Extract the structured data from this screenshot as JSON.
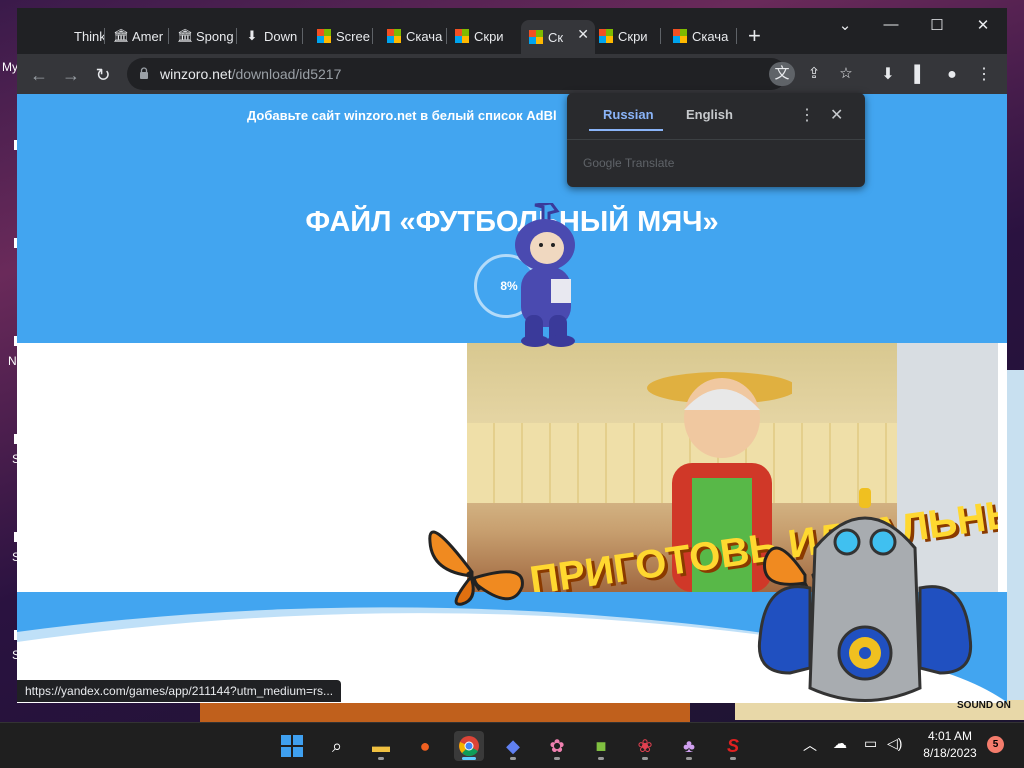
{
  "desktop": {
    "labels": [
      "My",
      "N",
      "S",
      "S",
      "S"
    ]
  },
  "tabs": [
    {
      "label": "Think",
      "icon": "document-icon"
    },
    {
      "label": "Amer",
      "icon": "bank-icon"
    },
    {
      "label": "Spong",
      "icon": "bank-icon"
    },
    {
      "label": "Down",
      "icon": "download-icon"
    },
    {
      "label": "Scree",
      "icon": "microsoft-icon"
    },
    {
      "label": "Скача",
      "icon": "microsoft-icon"
    },
    {
      "label": "Скри",
      "icon": "microsoft-icon"
    },
    {
      "label": "Ск",
      "icon": "microsoft-icon",
      "active": true
    },
    {
      "label": "Скри",
      "icon": "microsoft-icon"
    },
    {
      "label": "Скача",
      "icon": "microsoft-icon"
    }
  ],
  "address_bar": {
    "domain": "winzoro.net",
    "path": "/download/id5217"
  },
  "page": {
    "adblock_notice": "Добавьте сайт winzoro.net в белый список AdBl",
    "file_title": "ФАЙЛ «ФУТБОЛЬНЫЙ МЯЧ»",
    "progress": "8%",
    "ad_text": "ПРИГОТОВЬ ИДЕАЛЬНЫЙ ОБЕД!"
  },
  "translate_popup": {
    "source_lang": "Russian",
    "target_lang": "English",
    "brand": "Google Translate"
  },
  "status_url": "https://yandex.com/games/app/211144?utm_medium=rs...",
  "taskbar": {
    "time": "4:01 AM",
    "date": "8/18/2023",
    "notifications": "5"
  },
  "game_overlay": {
    "sound": "SOUND ON"
  },
  "colors": {
    "hero_blue": "#42a5f0",
    "chrome_dark": "#202124",
    "chrome_toolbar": "#35363a",
    "translate_accent": "#8ab4f8"
  }
}
